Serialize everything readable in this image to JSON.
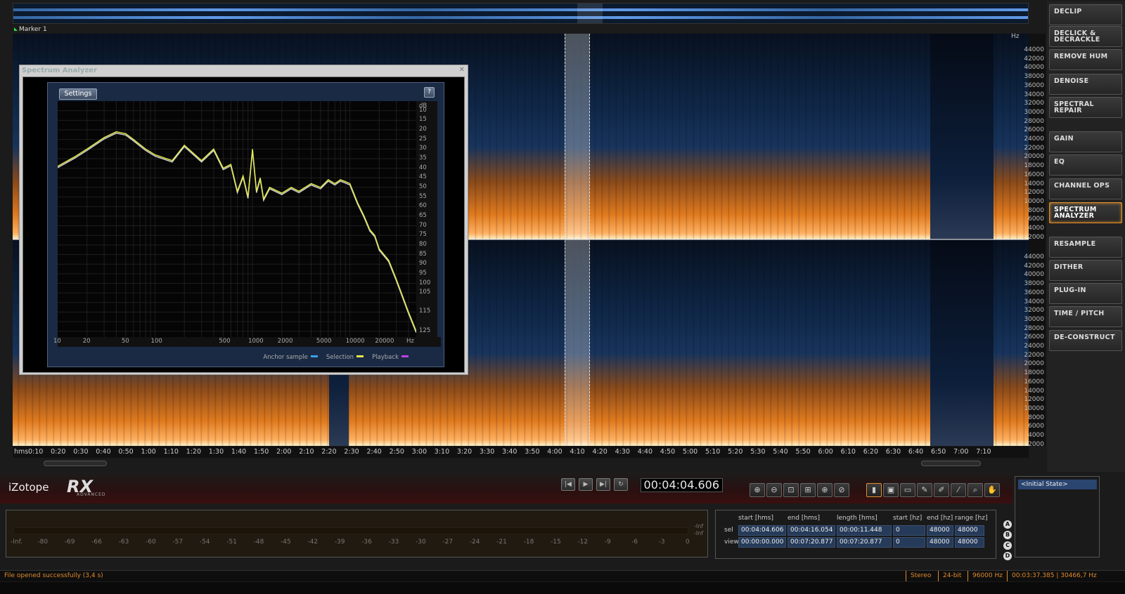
{
  "overview": {
    "marker": "Marker 1"
  },
  "spectrogram": {
    "hz_unit": "Hz",
    "hz_ticks_top": [
      "44000",
      "42000",
      "40000",
      "38000",
      "36000",
      "34000",
      "32000",
      "30000",
      "28000",
      "26000",
      "24000",
      "22000",
      "20000",
      "18000",
      "16000",
      "14000",
      "12000",
      "10000",
      "8000",
      "6000",
      "4000",
      "2000"
    ],
    "hz_ticks_bottom": [
      "44000",
      "42000",
      "40000",
      "38000",
      "36000",
      "34000",
      "32000",
      "30000",
      "28000",
      "26000",
      "24000",
      "22000",
      "20000",
      "18000",
      "16000",
      "14000",
      "12000",
      "10000",
      "8000",
      "6000",
      "4000",
      "2000"
    ],
    "time_unit": "hms",
    "time_ticks": [
      "0:10",
      "0:20",
      "0:30",
      "0:40",
      "0:50",
      "1:00",
      "1:10",
      "1:20",
      "1:30",
      "1:40",
      "1:50",
      "2:00",
      "2:10",
      "2:20",
      "2:30",
      "2:40",
      "2:50",
      "3:00",
      "3:10",
      "3:20",
      "3:30",
      "3:40",
      "3:50",
      "4:00",
      "4:10",
      "4:20",
      "4:30",
      "4:40",
      "4:50",
      "5:00",
      "5:10",
      "5:20",
      "5:30",
      "5:40",
      "5:50",
      "6:00",
      "6:10",
      "6:20",
      "6:30",
      "6:40",
      "6:50",
      "7:00",
      "7:10"
    ]
  },
  "modules": [
    {
      "label": "DECLIP"
    },
    {
      "label": "DECLICK & DECRACKLE"
    },
    {
      "label": "REMOVE HUM"
    },
    {
      "label": "DENOISE"
    },
    {
      "label": "SPECTRAL REPAIR"
    },
    {
      "label": "GAIN"
    },
    {
      "label": "EQ"
    },
    {
      "label": "CHANNEL OPS"
    },
    {
      "label": "SPECTRUM ANALYZER"
    },
    {
      "label": "RESAMPLE"
    },
    {
      "label": "DITHER"
    },
    {
      "label": "PLUG-IN"
    },
    {
      "label": "TIME / PITCH"
    },
    {
      "label": "DE-CONSTRUCT"
    }
  ],
  "spectrum_analyzer": {
    "title": "Spectrum Analyzer",
    "settings_label": "Settings",
    "help_label": "?",
    "db_unit": "dB",
    "db_ticks": [
      "10",
      "15",
      "20",
      "25",
      "30",
      "35",
      "40",
      "45",
      "50",
      "55",
      "60",
      "65",
      "70",
      "75",
      "80",
      "85",
      "90",
      "95",
      "100",
      "105",
      "115",
      "125"
    ],
    "hz_ticks": [
      "10",
      "20",
      "50",
      "100",
      "500",
      "1000",
      "2000",
      "5000",
      "10000",
      "20000",
      "Hz"
    ],
    "legend": [
      {
        "label": "Anchor sample",
        "color": "#3aa0e8"
      },
      {
        "label": "Selection",
        "color": "#e8e84a"
      },
      {
        "label": "Playback",
        "color": "#c040e8"
      }
    ]
  },
  "chart_data": {
    "type": "line",
    "xlabel": "Hz",
    "ylabel": "dB",
    "x_scale": "log",
    "xlim": [
      10,
      48000
    ],
    "ylim": [
      -128,
      -5
    ],
    "series": [
      {
        "name": "Selection",
        "x": [
          10,
          15,
          20,
          30,
          40,
          50,
          60,
          80,
          100,
          150,
          200,
          300,
          400,
          500,
          600,
          700,
          800,
          900,
          1000,
          1100,
          1200,
          1300,
          1500,
          2000,
          2500,
          3000,
          4000,
          5000,
          6000,
          7000,
          8000,
          9000,
          10000,
          12000,
          14000,
          16000,
          18000,
          20000,
          25000,
          30000,
          40000,
          48000
        ],
        "y": [
          -39,
          -34,
          -30,
          -24,
          -21,
          -22,
          -25,
          -30,
          -33,
          -36,
          -28,
          -36,
          -30,
          -40,
          -38,
          -52,
          -44,
          -55,
          -30,
          -52,
          -45,
          -56,
          -50,
          -53,
          -50,
          -52,
          -48,
          -50,
          -46,
          -48,
          -46,
          -47,
          -48,
          -58,
          -65,
          -72,
          -75,
          -82,
          -88,
          -98,
          -115,
          -125
        ]
      }
    ]
  },
  "transport": {
    "timecode": "00:04:04.606"
  },
  "logo": {
    "brand": "iZotope",
    "product": "RX",
    "edition": "ADVANCED"
  },
  "meter": {
    "scale": [
      "-Inf.",
      "-80",
      "-69",
      "-66",
      "-63",
      "-60",
      "-57",
      "-54",
      "-51",
      "-48",
      "-45",
      "-42",
      "-39",
      "-36",
      "-33",
      "-30",
      "-27",
      "-24",
      "-21",
      "-18",
      "-15",
      "-12",
      "-9",
      "-6",
      "-3",
      "0"
    ],
    "inf_top": "-Inf",
    "inf_bottom": "-Inf"
  },
  "selection_info": {
    "headers": [
      "start [hms]",
      "end [hms]",
      "length [hms]",
      "start [hz]",
      "end [hz]",
      "range [hz]"
    ],
    "rows": [
      {
        "label": "sel",
        "values": [
          "00:04:04.606",
          "00:04:16.054",
          "00:00:11.448",
          "0",
          "48000",
          "48000"
        ]
      },
      {
        "label": "view",
        "values": [
          "00:00:00.000",
          "00:07:20.877",
          "00:07:20.877",
          "0",
          "48000",
          "48000"
        ]
      }
    ],
    "slots": [
      "A",
      "B",
      "C",
      "D"
    ]
  },
  "history": {
    "items": [
      "<Initial State>"
    ]
  },
  "status": {
    "message": "File opened successfully (3,4 s)",
    "channels": "Stereo",
    "bitdepth": "24-bit",
    "samplerate": "96000 Hz",
    "position": "00:03:37.385 | 30466,7 Hz"
  }
}
